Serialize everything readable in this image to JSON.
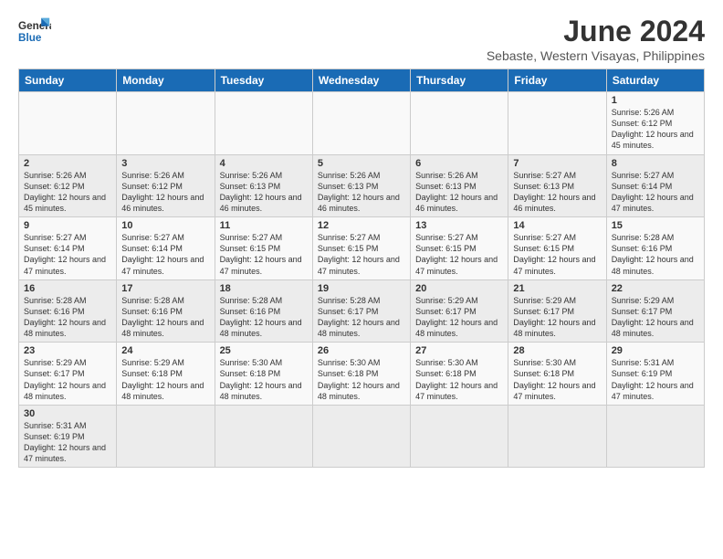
{
  "logo": {
    "text_general": "General",
    "text_blue": "Blue"
  },
  "header": {
    "month_year": "June 2024",
    "subtitle": "Sebaste, Western Visayas, Philippines"
  },
  "days_of_week": [
    "Sunday",
    "Monday",
    "Tuesday",
    "Wednesday",
    "Thursday",
    "Friday",
    "Saturday"
  ],
  "weeks": [
    [
      {
        "day": "",
        "info": ""
      },
      {
        "day": "",
        "info": ""
      },
      {
        "day": "",
        "info": ""
      },
      {
        "day": "",
        "info": ""
      },
      {
        "day": "",
        "info": ""
      },
      {
        "day": "",
        "info": ""
      },
      {
        "day": "1",
        "info": "Sunrise: 5:26 AM\nSunset: 6:12 PM\nDaylight: 12 hours\nand 45 minutes."
      }
    ],
    [
      {
        "day": "2",
        "info": "Sunrise: 5:26 AM\nSunset: 6:12 PM\nDaylight: 12 hours\nand 45 minutes."
      },
      {
        "day": "3",
        "info": "Sunrise: 5:26 AM\nSunset: 6:12 PM\nDaylight: 12 hours\nand 46 minutes."
      },
      {
        "day": "4",
        "info": "Sunrise: 5:26 AM\nSunset: 6:13 PM\nDaylight: 12 hours\nand 46 minutes."
      },
      {
        "day": "5",
        "info": "Sunrise: 5:26 AM\nSunset: 6:13 PM\nDaylight: 12 hours\nand 46 minutes."
      },
      {
        "day": "6",
        "info": "Sunrise: 5:26 AM\nSunset: 6:13 PM\nDaylight: 12 hours\nand 46 minutes."
      },
      {
        "day": "7",
        "info": "Sunrise: 5:27 AM\nSunset: 6:13 PM\nDaylight: 12 hours\nand 46 minutes."
      },
      {
        "day": "8",
        "info": "Sunrise: 5:27 AM\nSunset: 6:14 PM\nDaylight: 12 hours\nand 47 minutes."
      }
    ],
    [
      {
        "day": "9",
        "info": "Sunrise: 5:27 AM\nSunset: 6:14 PM\nDaylight: 12 hours\nand 47 minutes."
      },
      {
        "day": "10",
        "info": "Sunrise: 5:27 AM\nSunset: 6:14 PM\nDaylight: 12 hours\nand 47 minutes."
      },
      {
        "day": "11",
        "info": "Sunrise: 5:27 AM\nSunset: 6:15 PM\nDaylight: 12 hours\nand 47 minutes."
      },
      {
        "day": "12",
        "info": "Sunrise: 5:27 AM\nSunset: 6:15 PM\nDaylight: 12 hours\nand 47 minutes."
      },
      {
        "day": "13",
        "info": "Sunrise: 5:27 AM\nSunset: 6:15 PM\nDaylight: 12 hours\nand 47 minutes."
      },
      {
        "day": "14",
        "info": "Sunrise: 5:27 AM\nSunset: 6:15 PM\nDaylight: 12 hours\nand 47 minutes."
      },
      {
        "day": "15",
        "info": "Sunrise: 5:28 AM\nSunset: 6:16 PM\nDaylight: 12 hours\nand 48 minutes."
      }
    ],
    [
      {
        "day": "16",
        "info": "Sunrise: 5:28 AM\nSunset: 6:16 PM\nDaylight: 12 hours\nand 48 minutes."
      },
      {
        "day": "17",
        "info": "Sunrise: 5:28 AM\nSunset: 6:16 PM\nDaylight: 12 hours\nand 48 minutes."
      },
      {
        "day": "18",
        "info": "Sunrise: 5:28 AM\nSunset: 6:16 PM\nDaylight: 12 hours\nand 48 minutes."
      },
      {
        "day": "19",
        "info": "Sunrise: 5:28 AM\nSunset: 6:17 PM\nDaylight: 12 hours\nand 48 minutes."
      },
      {
        "day": "20",
        "info": "Sunrise: 5:29 AM\nSunset: 6:17 PM\nDaylight: 12 hours\nand 48 minutes."
      },
      {
        "day": "21",
        "info": "Sunrise: 5:29 AM\nSunset: 6:17 PM\nDaylight: 12 hours\nand 48 minutes."
      },
      {
        "day": "22",
        "info": "Sunrise: 5:29 AM\nSunset: 6:17 PM\nDaylight: 12 hours\nand 48 minutes."
      }
    ],
    [
      {
        "day": "23",
        "info": "Sunrise: 5:29 AM\nSunset: 6:17 PM\nDaylight: 12 hours\nand 48 minutes."
      },
      {
        "day": "24",
        "info": "Sunrise: 5:29 AM\nSunset: 6:18 PM\nDaylight: 12 hours\nand 48 minutes."
      },
      {
        "day": "25",
        "info": "Sunrise: 5:30 AM\nSunset: 6:18 PM\nDaylight: 12 hours\nand 48 minutes."
      },
      {
        "day": "26",
        "info": "Sunrise: 5:30 AM\nSunset: 6:18 PM\nDaylight: 12 hours\nand 48 minutes."
      },
      {
        "day": "27",
        "info": "Sunrise: 5:30 AM\nSunset: 6:18 PM\nDaylight: 12 hours\nand 47 minutes."
      },
      {
        "day": "28",
        "info": "Sunrise: 5:30 AM\nSunset: 6:18 PM\nDaylight: 12 hours\nand 47 minutes."
      },
      {
        "day": "29",
        "info": "Sunrise: 5:31 AM\nSunset: 6:19 PM\nDaylight: 12 hours\nand 47 minutes."
      }
    ],
    [
      {
        "day": "30",
        "info": "Sunrise: 5:31 AM\nSunset: 6:19 PM\nDaylight: 12 hours\nand 47 minutes."
      },
      {
        "day": "",
        "info": ""
      },
      {
        "day": "",
        "info": ""
      },
      {
        "day": "",
        "info": ""
      },
      {
        "day": "",
        "info": ""
      },
      {
        "day": "",
        "info": ""
      },
      {
        "day": "",
        "info": ""
      }
    ]
  ]
}
